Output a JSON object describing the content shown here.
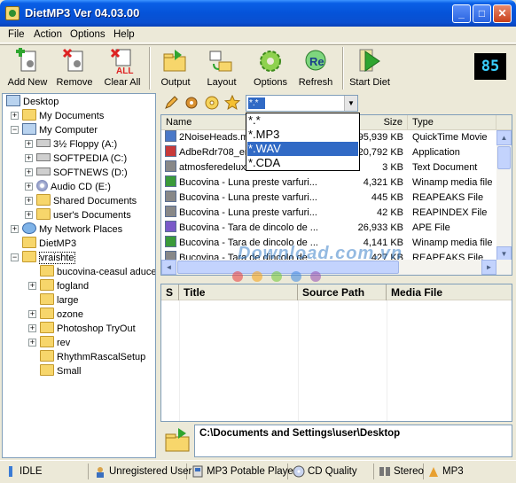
{
  "window": {
    "title": "DietMP3  Ver 04.03.00"
  },
  "menu": [
    "File",
    "Action",
    "Options",
    "Help"
  ],
  "toolbar": {
    "add_new": "Add New",
    "remove": "Remove",
    "clear_all": "Clear All",
    "output": "Output",
    "layout": "Layout",
    "options": "Options",
    "refresh": "Refresh",
    "start_diet": "Start Diet",
    "counter": "85"
  },
  "tree": [
    {
      "label": "Desktop"
    },
    {
      "label": "My Documents"
    },
    {
      "label": "My Computer"
    },
    {
      "label": "3½ Floppy (A:)"
    },
    {
      "label": "SOFTPEDIA (C:)"
    },
    {
      "label": "SOFTNEWS (D:)"
    },
    {
      "label": "Audio CD (E:)"
    },
    {
      "label": "Shared Documents"
    },
    {
      "label": "user's Documents"
    },
    {
      "label": "My Network Places"
    },
    {
      "label": "DietMP3"
    },
    {
      "label": "vraishte"
    },
    {
      "label": "bucovina-ceasul aduce"
    },
    {
      "label": "fogland"
    },
    {
      "label": "large"
    },
    {
      "label": "ozone"
    },
    {
      "label": "Photoshop TryOut"
    },
    {
      "label": "rev"
    },
    {
      "label": "RhythmRascalSetup"
    },
    {
      "label": "Small"
    }
  ],
  "filter": {
    "value": "*.*",
    "options": [
      "*.*",
      "*.MP3",
      "*.WAV",
      "*.CDA"
    ],
    "selected": "*.WAV"
  },
  "file_list": {
    "columns": {
      "name": "Name",
      "size": "Size",
      "type": "Type"
    },
    "rows": [
      {
        "name": "2NoiseHeads.m",
        "size": "95,939 KB",
        "type": "QuickTime Movie"
      },
      {
        "name": "AdbeRdr708_en",
        "size": "20,792 KB",
        "type": "Application"
      },
      {
        "name": "atmosferedeluxe",
        "size": "3 KB",
        "type": "Text Document"
      },
      {
        "name": "Bucovina - Luna preste varfuri...",
        "size": "4,321 KB",
        "type": "Winamp media file"
      },
      {
        "name": "Bucovina - Luna preste varfuri...",
        "size": "445 KB",
        "type": "REAPEAKS File"
      },
      {
        "name": "Bucovina - Luna preste varfuri...",
        "size": "42 KB",
        "type": "REAPINDEX File"
      },
      {
        "name": "Bucovina - Tara de dincolo de ...",
        "size": "26,933 KB",
        "type": "APE File"
      },
      {
        "name": "Bucovina - Tara de dincolo de ...",
        "size": "4,141 KB",
        "type": "Winamp media file"
      },
      {
        "name": "Bucovina - Tara de dincolo de ...",
        "size": "427 KB",
        "type": "REAPEAKS File"
      }
    ]
  },
  "watermark": "Download.com.vn",
  "queue": {
    "columns": [
      "S",
      "Title",
      "Source Path",
      "Media File"
    ]
  },
  "output_path": "C:\\Documents and Settings\\user\\Desktop",
  "status": {
    "state": "IDLE",
    "user": "Unregistered User",
    "player": "MP3 Potable Player",
    "quality": "CD Quality",
    "channels": "Stereo",
    "format": "MP3"
  }
}
